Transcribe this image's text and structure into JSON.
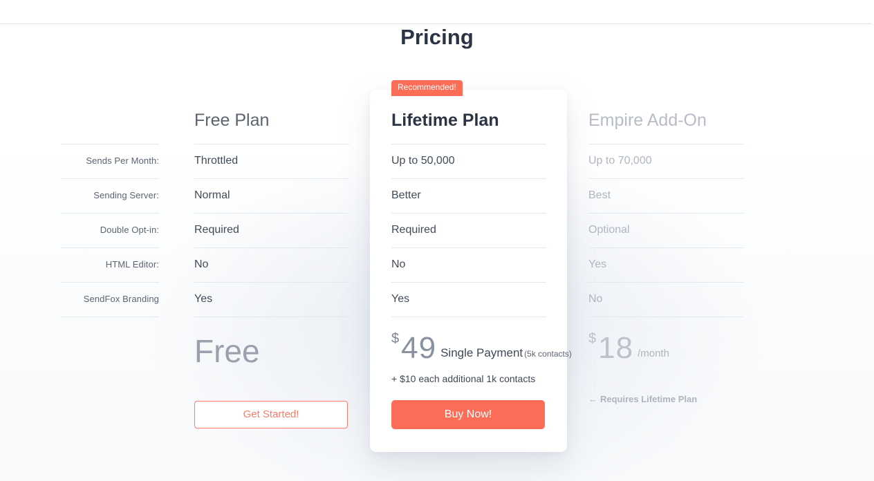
{
  "page": {
    "title": "Pricing"
  },
  "badge": {
    "label": "Recommended!"
  },
  "feature_labels": [
    "Sends Per Month:",
    "Sending Server:",
    "Double Opt-in:",
    "HTML Editor:",
    "SendFox Branding"
  ],
  "plans": {
    "free": {
      "name": "Free Plan",
      "features": [
        "Throttled",
        "Normal",
        "Required",
        "No",
        "Yes"
      ],
      "price_display": "Free",
      "cta_label": "Get Started!"
    },
    "lifetime": {
      "name": "Lifetime Plan",
      "features": [
        "Up to 50,000",
        "Better",
        "Required",
        "No",
        "Yes"
      ],
      "currency": "$",
      "amount": "49",
      "period": "Single Payment",
      "period_note": "(5k contacts)",
      "sub_note": "+ $10 each additional 1k contacts",
      "cta_label": "Buy Now!"
    },
    "empire": {
      "name": "Empire Add-On",
      "features": [
        "Up to 70,000",
        "Best",
        "Optional",
        "Yes",
        "No"
      ],
      "currency": "$",
      "amount": "18",
      "period": "/month",
      "requires_arrow": "←",
      "requires_note": "Requires Lifetime Plan"
    }
  },
  "colors": {
    "accent": "#fb6d56",
    "accent_outline": "#fb7b68",
    "title": "#2b3445",
    "text": "#414b58",
    "muted": "#b0b6c0",
    "rule": "#e3e8ef"
  }
}
